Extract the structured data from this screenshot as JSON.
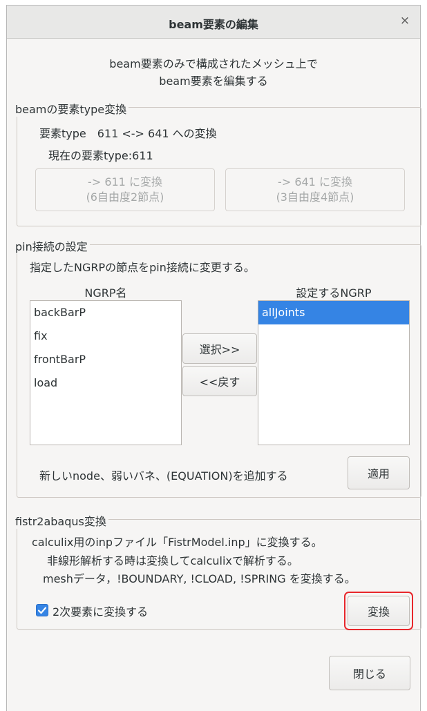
{
  "window": {
    "title": "beam要素の編集",
    "close_label": "×"
  },
  "intro": {
    "line1": "beam要素のみで構成されたメッシュ上で",
    "line2": "beam要素を編集する"
  },
  "type_section": {
    "label": "beamの要素type変換",
    "description": "要素type　611 <-> 641 への変換",
    "current": "現在の要素type:611",
    "btn611_line1": "-> 611 に変換",
    "btn611_line2": "(6自由度2節点)",
    "btn641_line1": "-> 641 に変換",
    "btn641_line2": "(3自由度4節点)"
  },
  "pin_section": {
    "label": "pin接続の設定",
    "description": "指定したNGRPの節点をpin接続に変更する。",
    "ngrp_header": "NGRP名",
    "selected_header": "設定するNGRP",
    "ngrp_items": [
      "backBarP",
      "fix",
      "frontBarP",
      "load"
    ],
    "selected_items": [
      "allJoints"
    ],
    "select_button": "選択>>",
    "back_button": "<<戻す",
    "apply_text": "新しいnode、弱いバネ、(EQUATION)を追加する",
    "apply_button": "適用"
  },
  "abaqus_section": {
    "label": "fistr2abaqus変換",
    "line1": "calculix用のinpファイル「FistrModel.inp」に変換する。",
    "line2": "非線形解析する時は変換してcalculixで解析する。",
    "line3": "meshデータ，!BOUNDARY, !CLOAD, !SPRING を変換する。",
    "checkbox_label": "2次要素に変換する",
    "checkbox_checked": true,
    "convert_button": "変換"
  },
  "footer": {
    "close_button": "閉じる"
  }
}
